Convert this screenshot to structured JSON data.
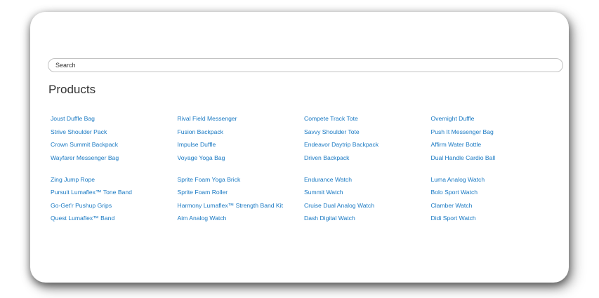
{
  "search": {
    "placeholder": "Search"
  },
  "page_title": "Products",
  "colors": {
    "link": "#1979c3",
    "text": "#333333",
    "border": "#c2c2c2"
  },
  "product_groups": [
    {
      "columns": [
        [
          "Joust Duffle Bag",
          "Strive Shoulder Pack",
          "Crown Summit Backpack",
          "Wayfarer Messenger Bag"
        ],
        [
          "Rival Field Messenger",
          "Fusion Backpack",
          "Impulse Duffle",
          "Voyage Yoga Bag"
        ],
        [
          "Compete Track Tote",
          "Savvy Shoulder Tote",
          "Endeavor Daytrip Backpack",
          "Driven Backpack"
        ],
        [
          "Overnight Duffle",
          "Push It Messenger Bag",
          "Affirm Water Bottle",
          "Dual Handle Cardio Ball"
        ]
      ]
    },
    {
      "columns": [
        [
          "Zing Jump Rope",
          "Pursuit Lumaflex™ Tone Band",
          "Go-Get'r Pushup Grips",
          "Quest Lumaflex™ Band"
        ],
        [
          "Sprite Foam Yoga Brick",
          "Sprite Foam Roller",
          "Harmony Lumaflex™ Strength Band Kit",
          "Aim Analog Watch"
        ],
        [
          "Endurance Watch",
          "Summit Watch",
          "Cruise Dual Analog Watch",
          "Dash Digital Watch"
        ],
        [
          "Luma Analog Watch",
          "Bolo Sport Watch",
          "Clamber Watch",
          "Didi Sport Watch"
        ]
      ]
    }
  ]
}
